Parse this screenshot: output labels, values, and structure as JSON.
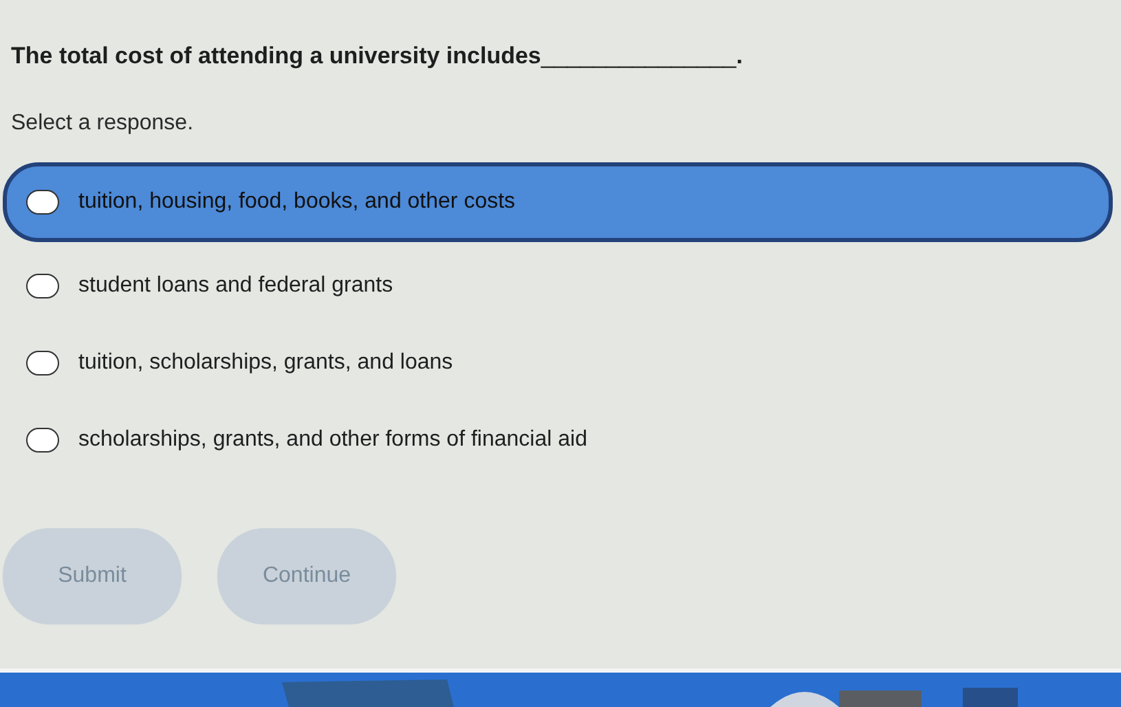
{
  "question": {
    "text": "The total cost of attending a university includes",
    "blank": "_______________",
    "end": "."
  },
  "prompt": "Select a response.",
  "options": [
    {
      "label": "tuition, housing, food, books, and other costs",
      "selected": true
    },
    {
      "label": "student loans and federal grants",
      "selected": false
    },
    {
      "label": "tuition, scholarships, grants, and loans",
      "selected": false
    },
    {
      "label": "scholarships, grants, and other forms of financial aid",
      "selected": false
    }
  ],
  "buttons": [
    {
      "label": "Submit",
      "disabled": true
    },
    {
      "label": "Continue",
      "disabled": true
    }
  ]
}
